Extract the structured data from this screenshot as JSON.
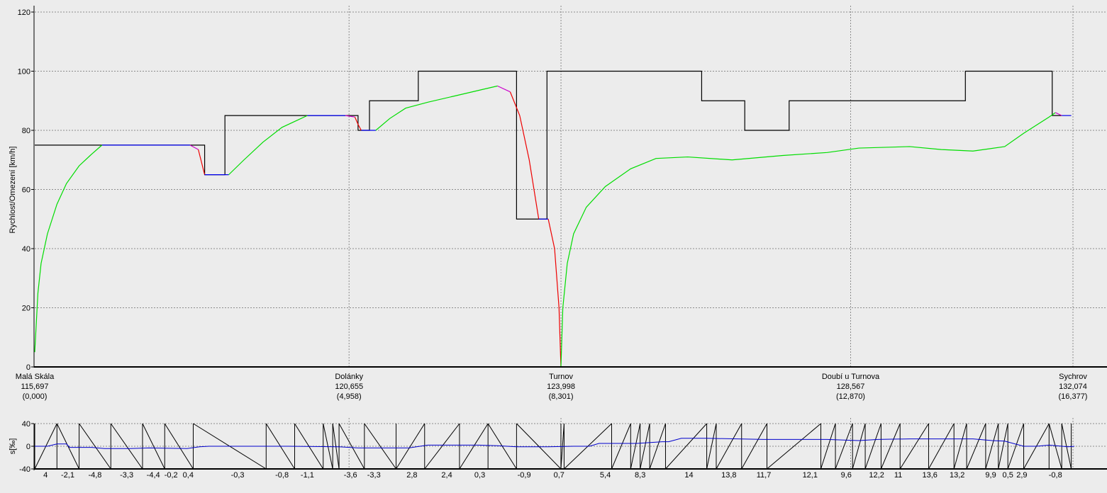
{
  "chart_data": [
    {
      "type": "line",
      "ylabel": "Rychlost/Omezení [km/h]",
      "ylim": [
        0,
        120
      ],
      "yticks": [
        0,
        20,
        40,
        60,
        80,
        100,
        120
      ],
      "xlim": [
        0,
        16.8
      ],
      "grid": true,
      "colors": {
        "limit": "#000000",
        "accelerating": "#00dd00",
        "braking": "#ee0000",
        "coasting": "#cc00cc",
        "constant": "#0000ee"
      },
      "stations": [
        {
          "name": "Malá Skála",
          "km": "115,697",
          "rel": "(0,000)",
          "x": 0.0
        },
        {
          "name": "Dolánky",
          "km": "120,655",
          "rel": "(4,958)",
          "x": 4.958
        },
        {
          "name": "Turnov",
          "km": "123,998",
          "rel": "(8,301)",
          "x": 8.301
        },
        {
          "name": "Doubí u Turnova",
          "km": "128,567",
          "rel": "(12,870)",
          "x": 12.87
        },
        {
          "name": "Sychrov",
          "km": "132,074",
          "rel": "(16,377)",
          "x": 16.377
        }
      ],
      "speed_limit": [
        [
          0,
          75
        ],
        [
          2.68,
          75
        ],
        [
          2.68,
          65
        ],
        [
          3.0,
          65
        ],
        [
          3.0,
          85
        ],
        [
          5.1,
          85
        ],
        [
          5.1,
          80
        ],
        [
          5.28,
          80
        ],
        [
          5.28,
          90
        ],
        [
          6.05,
          90
        ],
        [
          6.05,
          100
        ],
        [
          7.6,
          100
        ],
        [
          7.6,
          50
        ],
        [
          8.08,
          50
        ],
        [
          8.08,
          100
        ],
        [
          10.52,
          100
        ],
        [
          10.52,
          90
        ],
        [
          11.2,
          90
        ],
        [
          11.2,
          80
        ],
        [
          11.9,
          80
        ],
        [
          11.9,
          90
        ],
        [
          14.68,
          90
        ],
        [
          14.68,
          100
        ],
        [
          16.05,
          100
        ],
        [
          16.05,
          85
        ],
        [
          16.2,
          85
        ]
      ],
      "series": [
        {
          "role": "accelerating",
          "points": [
            [
              0,
              5
            ],
            [
              0.05,
              25
            ],
            [
              0.1,
              35
            ],
            [
              0.2,
              45
            ],
            [
              0.35,
              55
            ],
            [
              0.5,
              62
            ],
            [
              0.7,
              68
            ],
            [
              0.9,
              72
            ],
            [
              1.06,
              75
            ]
          ]
        },
        {
          "role": "constant",
          "points": [
            [
              1.06,
              75
            ],
            [
              2.45,
              75
            ]
          ]
        },
        {
          "role": "coasting",
          "points": [
            [
              2.45,
              75
            ],
            [
              2.58,
              73.5
            ]
          ]
        },
        {
          "role": "braking",
          "points": [
            [
              2.58,
              73.5
            ],
            [
              2.68,
              65
            ]
          ]
        },
        {
          "role": "constant",
          "points": [
            [
              2.68,
              65
            ],
            [
              3.06,
              65
            ]
          ]
        },
        {
          "role": "accelerating",
          "points": [
            [
              3.06,
              65
            ],
            [
              3.3,
              70
            ],
            [
              3.6,
              76
            ],
            [
              3.9,
              81
            ],
            [
              4.2,
              84
            ],
            [
              4.3,
              85
            ]
          ]
        },
        {
          "role": "constant",
          "points": [
            [
              4.3,
              85
            ],
            [
              4.9,
              85
            ]
          ]
        },
        {
          "role": "coasting",
          "points": [
            [
              4.9,
              85
            ],
            [
              5.05,
              84.5
            ]
          ]
        },
        {
          "role": "braking",
          "points": [
            [
              5.05,
              84.5
            ],
            [
              5.1,
              82
            ],
            [
              5.15,
              80
            ]
          ]
        },
        {
          "role": "constant",
          "points": [
            [
              5.15,
              80
            ],
            [
              5.38,
              80
            ]
          ]
        },
        {
          "role": "accelerating",
          "points": [
            [
              5.38,
              80
            ],
            [
              5.6,
              84
            ],
            [
              5.85,
              87.5
            ],
            [
              6.2,
              89.5
            ],
            [
              6.6,
              91.5
            ],
            [
              7.0,
              93.5
            ],
            [
              7.3,
              95
            ]
          ]
        },
        {
          "role": "coasting",
          "points": [
            [
              7.3,
              95
            ],
            [
              7.5,
              93
            ]
          ]
        },
        {
          "role": "braking",
          "points": [
            [
              7.5,
              93
            ],
            [
              7.65,
              85
            ],
            [
              7.8,
              70
            ],
            [
              7.95,
              50
            ]
          ]
        },
        {
          "role": "constant",
          "points": [
            [
              7.95,
              50
            ],
            [
              8.1,
              50
            ]
          ]
        },
        {
          "role": "braking",
          "points": [
            [
              8.1,
              50
            ],
            [
              8.2,
              40
            ],
            [
              8.27,
              20
            ],
            [
              8.3,
              0
            ]
          ]
        },
        {
          "role": "accelerating",
          "points": [
            [
              8.3,
              0
            ],
            [
              8.33,
              20
            ],
            [
              8.4,
              35
            ],
            [
              8.5,
              45
            ],
            [
              8.7,
              54
            ],
            [
              9.0,
              61
            ],
            [
              9.4,
              67
            ],
            [
              9.8,
              70.5
            ],
            [
              10.3,
              71
            ],
            [
              11.0,
              70
            ],
            [
              11.8,
              71.5
            ],
            [
              12.5,
              72.5
            ],
            [
              13.0,
              74
            ],
            [
              13.8,
              74.5
            ],
            [
              14.3,
              73.5
            ],
            [
              14.8,
              73
            ],
            [
              15.3,
              74.5
            ],
            [
              15.6,
              79
            ],
            [
              16.0,
              84.5
            ],
            [
              16.1,
              86
            ]
          ]
        },
        {
          "role": "coasting",
          "points": [
            [
              16.1,
              86
            ],
            [
              16.2,
              85
            ]
          ]
        },
        {
          "role": "constant",
          "points": [
            [
              16.2,
              85
            ],
            [
              16.35,
              85
            ]
          ]
        }
      ]
    },
    {
      "type": "line",
      "ylabel": "s[‰]",
      "ylim": [
        -40,
        40
      ],
      "yticks": [
        -40,
        0,
        40
      ],
      "xlim": [
        0,
        16.8
      ],
      "gradient_profile": [
        [
          0,
          0
        ],
        [
          0.2,
          0
        ],
        [
          0.35,
          4
        ],
        [
          0.5,
          4
        ],
        [
          0.55,
          -2
        ],
        [
          0.9,
          -2
        ],
        [
          1.1,
          -4
        ],
        [
          1.5,
          -4
        ],
        [
          1.8,
          -3
        ],
        [
          2.4,
          -4
        ],
        [
          2.6,
          -1
        ],
        [
          2.75,
          0
        ],
        [
          3.2,
          0
        ],
        [
          4.0,
          0
        ],
        [
          4.8,
          -1
        ],
        [
          5.1,
          -3
        ],
        [
          5.6,
          -3
        ],
        [
          5.9,
          -3
        ],
        [
          6.2,
          2
        ],
        [
          6.7,
          2
        ],
        [
          7.0,
          2
        ],
        [
          7.3,
          1
        ],
        [
          7.6,
          -1
        ],
        [
          8.1,
          -1
        ],
        [
          8.5,
          0
        ],
        [
          8.75,
          0
        ],
        [
          8.9,
          5
        ],
        [
          9.5,
          5
        ],
        [
          9.9,
          8
        ],
        [
          10.0,
          8
        ],
        [
          10.2,
          14
        ],
        [
          10.6,
          14
        ],
        [
          11.5,
          12
        ],
        [
          12.5,
          12
        ],
        [
          13.0,
          10
        ],
        [
          13.3,
          12
        ],
        [
          13.8,
          13
        ],
        [
          14.3,
          13
        ],
        [
          14.8,
          13
        ],
        [
          15.1,
          10
        ],
        [
          15.3,
          9
        ],
        [
          15.6,
          0
        ],
        [
          15.8,
          0
        ],
        [
          16.0,
          2
        ],
        [
          16.3,
          -1
        ],
        [
          16.4,
          0
        ]
      ],
      "segment_breaks": [
        0,
        0.35,
        0.7,
        1.2,
        1.7,
        2.05,
        2.5,
        3.65,
        4.1,
        4.55,
        4.7,
        4.8,
        5.2,
        5.7,
        6.15,
        6.7,
        7.15,
        7.6,
        8.3,
        8.35,
        9.1,
        9.4,
        9.55,
        9.7,
        9.95,
        10.6,
        10.75,
        11.15,
        11.55,
        12.4,
        12.63,
        12.9,
        13.1,
        13.35,
        13.65,
        14.1,
        14.5,
        14.7,
        15.0,
        15.2,
        15.35,
        15.6,
        16.0,
        16.2,
        16.35
      ],
      "segment_labels": [
        {
          "x": 0.17,
          "label": "4"
        },
        {
          "x": 0.52,
          "label": "-2,1"
        },
        {
          "x": 0.95,
          "label": "-4,8"
        },
        {
          "x": 1.45,
          "label": "-3,3"
        },
        {
          "x": 1.87,
          "label": "-4,4"
        },
        {
          "x": 2.15,
          "label": "-0,2"
        },
        {
          "x": 2.42,
          "label": "0,4"
        },
        {
          "x": 3.2,
          "label": "-0,3"
        },
        {
          "x": 3.9,
          "label": "-0,8"
        },
        {
          "x": 4.3,
          "label": "-1,1"
        },
        {
          "x": 4.98,
          "label": "-3,6"
        },
        {
          "x": 5.35,
          "label": "-3,3"
        },
        {
          "x": 5.95,
          "label": "2,8"
        },
        {
          "x": 6.5,
          "label": "2,4"
        },
        {
          "x": 7.02,
          "label": "0,3"
        },
        {
          "x": 7.72,
          "label": "-0,9"
        },
        {
          "x": 8.27,
          "label": "0,7"
        },
        {
          "x": 9.0,
          "label": "5,4"
        },
        {
          "x": 9.55,
          "label": "8,3"
        },
        {
          "x": 10.32,
          "label": "14"
        },
        {
          "x": 10.95,
          "label": "13,8"
        },
        {
          "x": 11.5,
          "label": "11,7"
        },
        {
          "x": 12.23,
          "label": "12,1"
        },
        {
          "x": 12.8,
          "label": "9,6"
        },
        {
          "x": 13.28,
          "label": "12,2"
        },
        {
          "x": 13.62,
          "label": "11"
        },
        {
          "x": 14.12,
          "label": "13,6"
        },
        {
          "x": 14.55,
          "label": "13,2"
        },
        {
          "x": 15.08,
          "label": "9,9"
        },
        {
          "x": 15.35,
          "label": "0,5"
        },
        {
          "x": 15.57,
          "label": "2,9"
        },
        {
          "x": 16.1,
          "label": "-0,8"
        }
      ]
    }
  ]
}
